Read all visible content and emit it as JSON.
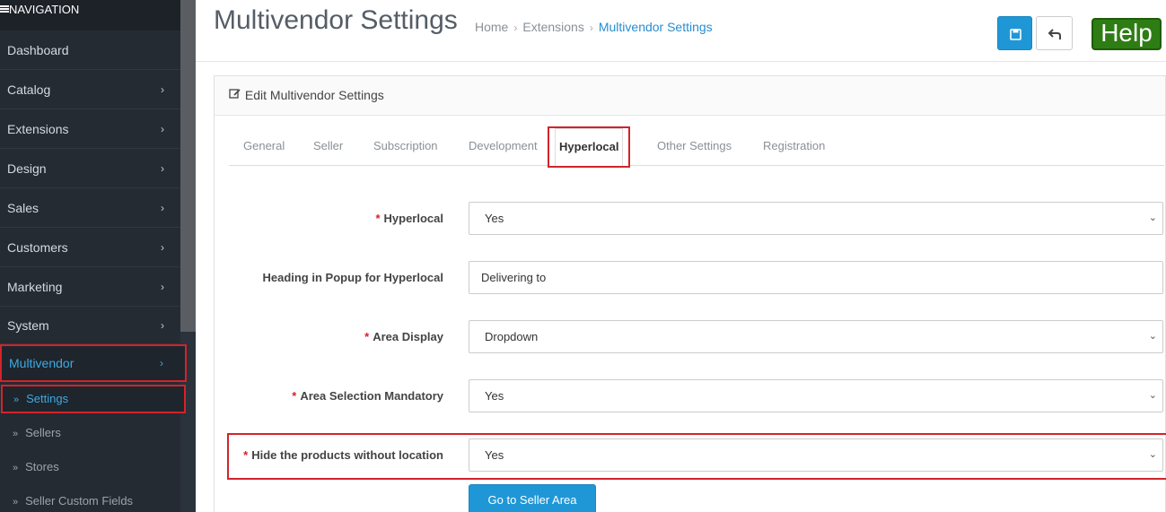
{
  "sidebar": {
    "header": "NAVIGATION",
    "items": [
      {
        "label": "Dashboard"
      },
      {
        "label": "Catalog"
      },
      {
        "label": "Extensions"
      },
      {
        "label": "Design"
      },
      {
        "label": "Sales"
      },
      {
        "label": "Customers"
      },
      {
        "label": "Marketing"
      },
      {
        "label": "System"
      },
      {
        "label": "Multivendor"
      }
    ],
    "subitems": [
      {
        "label": "Settings"
      },
      {
        "label": "Sellers"
      },
      {
        "label": "Stores"
      },
      {
        "label": "Seller Custom Fields"
      }
    ]
  },
  "header": {
    "title": "Multivendor Settings",
    "breadcrumb": [
      "Home",
      "Extensions",
      "Multivendor Settings"
    ],
    "help_label": "Help"
  },
  "panel": {
    "title": "Edit Multivendor Settings",
    "tabs": [
      "General",
      "Seller",
      "Subscription",
      "Development",
      "Hyperlocal",
      "Other Settings",
      "Registration"
    ],
    "fields": [
      {
        "label": "Hyperlocal",
        "value": "Yes"
      },
      {
        "label": "Heading in Popup for Hyperlocal",
        "value": "Delivering to"
      },
      {
        "label": "Area Display",
        "value": "Dropdown"
      },
      {
        "label": "Area Selection Mandatory",
        "value": "Yes"
      },
      {
        "label": "Hide the products without location",
        "value": "Yes"
      }
    ],
    "seller_button": "Go to Seller Area"
  },
  "colors": {
    "accent": "#1f97d6",
    "highlight": "#d3232b",
    "help": "#2e7d14",
    "sidebar": "#242b33"
  }
}
